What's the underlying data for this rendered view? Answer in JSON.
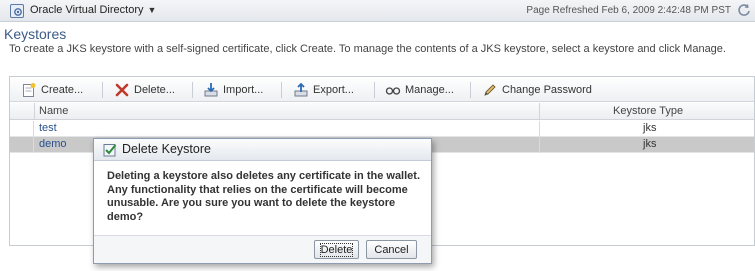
{
  "header": {
    "app_menu_label": "Oracle Virtual Directory",
    "refresh_text": "Page Refreshed Feb 6, 2009 2:42:48 PM PST"
  },
  "page": {
    "title": "Keystores",
    "description": "To create a JKS keystore with a self-signed certificate, click Create. To manage the contents of a JKS keystore, select a keystore and click Manage."
  },
  "toolbar": {
    "create": "Create...",
    "delete": "Delete...",
    "import": "Import...",
    "export": "Export...",
    "manage": "Manage...",
    "change_password": "Change Password"
  },
  "table": {
    "columns": [
      "Name",
      "Keystore Type"
    ],
    "rows": [
      {
        "name": "test",
        "type": "jks",
        "selected": false
      },
      {
        "name": "demo",
        "type": "jks",
        "selected": true
      }
    ]
  },
  "dialog": {
    "title": "Delete Keystore",
    "message": "Deleting a keystore also deletes any certificate in the wallet. Any functionality that relies on the certificate will become unusable. Are you sure you want to delete the keystore demo?",
    "delete_label": "Delete",
    "cancel_label": "Cancel"
  },
  "colors": {
    "link": "#2a4f8c",
    "title": "#3c5a85",
    "selected_row": "#c9c9c9",
    "delete_icon": "#c0392b"
  }
}
